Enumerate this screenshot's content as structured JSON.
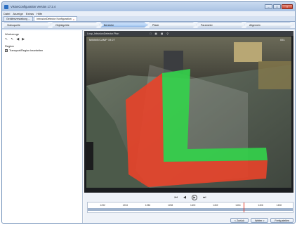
{
  "window": {
    "title": "VisionConfiguration Version 17.2.4",
    "controls": {
      "minimize": "–",
      "maximize": "□",
      "close": "×"
    }
  },
  "menu": [
    "Datei",
    "Anzeige",
    "Extras",
    "Hilfe"
  ],
  "tabs": [
    {
      "label": "Gerätesverwaltung ..."
    },
    {
      "label": "IntrusionDetector Konfiguration",
      "close": "×"
    }
  ],
  "wizard_steps": [
    "Videoquelle",
    "Objektgröße",
    "Bereiche",
    "Pfade",
    "Parameter",
    "Allgemein"
  ],
  "left_panel": {
    "tools_title": "Werkzeuge",
    "tool_icons": [
      "↖",
      "↖",
      "◀",
      "▶"
    ],
    "region_title": "Region",
    "checkbox_mark": "✓",
    "checkbox_label": "Transport/Region bearbeiten"
  },
  "video": {
    "header_title": "Loop_IntrusionDetector.Plan",
    "overlay_top_left": "MB/ME/CAMP 19:27",
    "overlay_top_right": "051",
    "tool_icons": [
      "□",
      "▦",
      "▦",
      "⚲"
    ],
    "colors": {
      "red": "#e5432a",
      "green": "#33d34a"
    }
  },
  "player": {
    "buttons": [
      "⏮",
      "◀",
      "▶",
      "⏭"
    ]
  },
  "timeline": {
    "ticks": [
      "1232",
      "1234",
      "1236",
      "1238",
      "1400",
      "1402",
      "1404",
      "1406",
      "1408"
    ]
  },
  "footer": {
    "back": "< Zurück",
    "next": "Weiter >",
    "finish": "Fertig stellen"
  }
}
